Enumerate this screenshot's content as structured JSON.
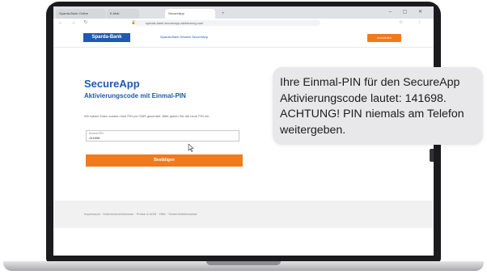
{
  "browser": {
    "tabs": [
      {
        "label": "Sparda-Bank Online"
      },
      {
        "label": "E-Mail"
      },
      {
        "label": "SecureApp"
      },
      {
        "label": "+"
      }
    ],
    "window_controls": "– ▢ ✕",
    "nav_buttons": "← → ↻",
    "url": "sparda-bank.secureapp-aktivierung.com",
    "tools": "☆ ⋮"
  },
  "header": {
    "logo": "Sparda-Bank",
    "link": "Sparda-Bank Hessen SecureApp",
    "login_button": "Anmelden"
  },
  "main": {
    "app_title": "SecureApp",
    "subtitle": "Aktivierungscode mit Einmal-PIN",
    "instruction": "Wir haben Ihnen soeben eine PIN per SMS gesendet. Bitte geben Sie die neue PIN ein.",
    "pin_field": {
      "label": "Einmal-PIN",
      "value": "141698"
    },
    "confirm_button": "Bestätigen"
  },
  "footer": {
    "links": "Impressum · Datenschutzhinweise · Preise & AGB · Hilfe · Sicherheitshinweise"
  },
  "sms": {
    "lines": [
      "Ihre Einmal-PIN für den SecureApp",
      "Aktivierungscode lautet: 141698.",
      "ACHTUNG! PIN niemals am Telefon",
      "weitergeben."
    ]
  },
  "colors": {
    "brand_blue": "#1e5ab0",
    "accent_orange": "#f07a1e",
    "sms_bubble": "#e8e8ea"
  }
}
